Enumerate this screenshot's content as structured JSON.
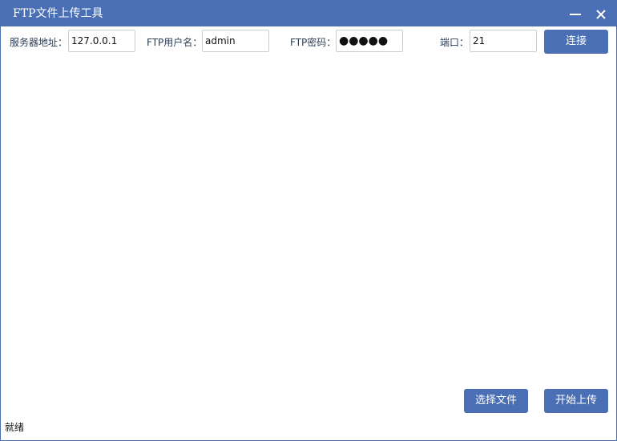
{
  "window": {
    "title": "FTP文件上传工具"
  },
  "form": {
    "server": {
      "label": "服务器地址：",
      "value": "127.0.0.1"
    },
    "username": {
      "label": "FTP用户名：",
      "value": "admin"
    },
    "password": {
      "label": "FTP密码：",
      "value": "●●●●●"
    },
    "port": {
      "label": "端口：",
      "value": "21"
    },
    "connect_label": "连接"
  },
  "actions": {
    "select_file_label": "选择文件",
    "start_upload_label": "开始上传"
  },
  "status": {
    "text": "就绪"
  },
  "colors": {
    "accent": "#4a6fb5",
    "text": "#2c3e55",
    "input_border": "#c8ccd3"
  }
}
